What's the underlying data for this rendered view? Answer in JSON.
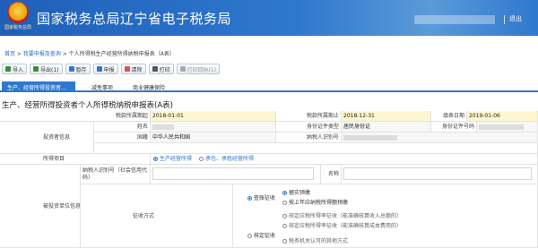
{
  "header": {
    "logo_text": "国家税务总局",
    "title": "国家税务总局辽宁省电子税务局",
    "logout": "退出",
    "colors": {
      "bar": "#2f78cf",
      "accent": "#1f5fb8"
    }
  },
  "breadcrumb": {
    "home": "首页",
    "sep1": " > ",
    "level2": "我要申报及查询",
    "sep2": " > ",
    "current": "个人所得税生产经营所得纳税申报表（A表）"
  },
  "toolbar": {
    "buttons": [
      {
        "label": "导入",
        "icon": "import-icon",
        "color": "#3a8b3a"
      },
      {
        "label": "导出(1)",
        "icon": "export-icon",
        "color": "#3a8b3a"
      },
      {
        "label": "暂存",
        "icon": "save-icon",
        "color": "#2f78cf"
      },
      {
        "label": "申报",
        "icon": "submit-icon",
        "color": "#2f78cf"
      },
      {
        "label": "清除",
        "icon": "clear-icon",
        "color": "#d9534f"
      },
      {
        "label": "打印",
        "icon": "print-icon",
        "color": "#555555"
      },
      {
        "label": "打印回执(1)",
        "icon": "receipt-icon",
        "color": "#999999"
      }
    ]
  },
  "tabs": [
    "生产、经营所得投资者...",
    "减免事项",
    "商业健康保险"
  ],
  "form": {
    "title": "生产、经营所得投资者个人所得税纳税申报表(A表)",
    "period_start_label": "税款所属期起",
    "period_start_value": "2018-01-01",
    "period_end_label": "税款所属期止",
    "period_end_value": "2018-12-31",
    "fill_date_label": "填表日期",
    "fill_date_value": "2019-01-06",
    "investor_info_label": "投资者信息",
    "name_label": "姓名",
    "id_type_label": "身份证件类型",
    "id_type_value": "居民身份证",
    "id_number_label": "身份证件号码",
    "nationality_label": "国籍",
    "nationality_value": "中华人民共和国",
    "taxpayer_id_label": "纳税人识别号",
    "income_item_label": "所得项目",
    "income_item_opt1": "生产经营所得",
    "income_item_opt2": "承包、承租经营所得",
    "invested_unit_label": "被投资单位信息",
    "taxpayer_code_label": "纳税人识别号（社会信用代码）",
    "unit_name_label": "名称",
    "levy_method_label": "征收方式",
    "levy_audit": "查账征收",
    "levy_approved": "核定征收",
    "levy_options": [
      "据实预缴",
      "按上年应纳税所得额预缴",
      "核定应税所得率征收（能准确核算收入总额的）",
      "核定应税所得率征收（能准确核算成本费用的）",
      "税务机关认可的其他方式"
    ]
  }
}
